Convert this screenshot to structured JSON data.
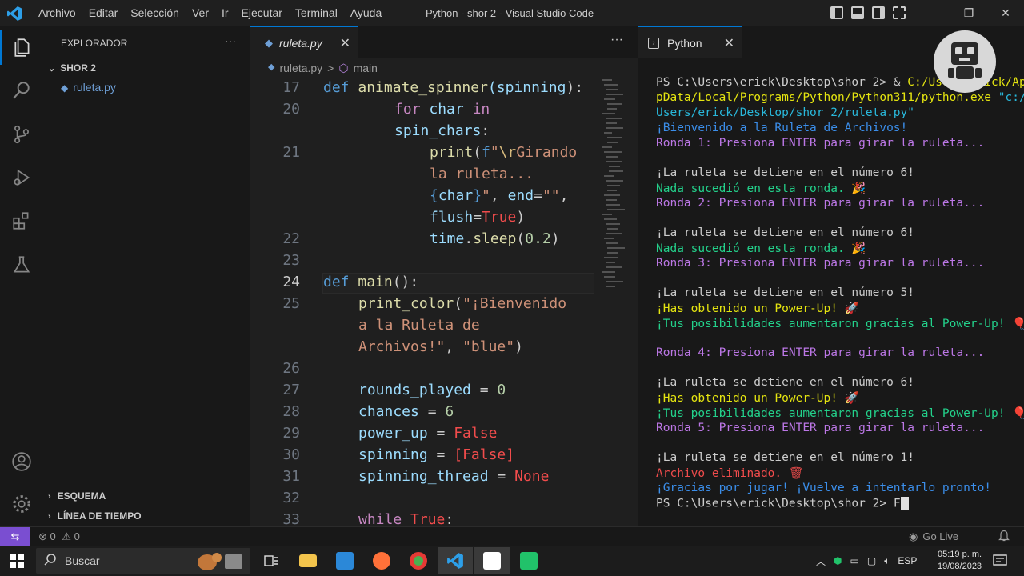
{
  "titlebar": {
    "menu": [
      "Archivo",
      "Editar",
      "Selección",
      "Ver",
      "Ir",
      "Ejecutar",
      "Terminal",
      "Ayuda"
    ],
    "title": "Python - shor 2 - Visual Studio Code",
    "controls": {
      "minimize": "—",
      "restore": "❐",
      "close": "✕"
    }
  },
  "sidebar": {
    "title": "EXPLORADOR",
    "more": "···",
    "folder": "SHOR 2",
    "files": [
      "ruleta.py"
    ],
    "outline": "ESQUEMA",
    "timeline": "LÍNEA DE TIEMPO"
  },
  "editor": {
    "tab": "ruleta.py",
    "tab_close": "✕",
    "more": "···",
    "breadcrumb": {
      "file": "ruleta.py",
      "sep": ">",
      "symbol": "main"
    },
    "line_numbers": [
      "17",
      "20",
      "21",
      "22",
      "23",
      "24",
      "25",
      "26",
      "27",
      "28",
      "29",
      "30",
      "31",
      "32",
      "33"
    ],
    "current_line": "24"
  },
  "panel": {
    "tab": "Python",
    "tab_close": "✕",
    "lines": [
      "PS C:\\Users\\erick\\Desktop\\shor 2> & ",
      "C:/Users/erick/Ap",
      "pData/Local/Programs/Python/Python311/python.exe ",
      "\"c:/",
      "Users/erick/Desktop/shor 2/ruleta.py\"",
      "¡Bienvenido a la Ruleta de Archivos!",
      "Ronda 1: Presiona ENTER para girar la ruleta...",
      "¡La ruleta se detiene en el número 6!",
      "Nada sucedió en esta ronda. 🎉",
      "Ronda 2: Presiona ENTER para girar la ruleta...",
      "¡La ruleta se detiene en el número 6!",
      "Nada sucedió en esta ronda. 🎉",
      "Ronda 3: Presiona ENTER para girar la ruleta...",
      "¡La ruleta se detiene en el número 5!",
      "¡Has obtenido un Power-Up! 🚀",
      "¡Tus posibilidades aumentaron gracias al Power-Up! 🎈",
      "Ronda 4: Presiona ENTER para girar la ruleta...",
      "¡La ruleta se detiene en el número 6!",
      "¡Has obtenido un Power-Up! 🚀",
      "¡Tus posibilidades aumentaron gracias al Power-Up! 🎈",
      "Ronda 5: Presiona ENTER para girar la ruleta...",
      "¡La ruleta se detiene en el número 1!",
      "Archivo eliminado. 🗑",
      "¡Gracias por jugar! ¡Vuelve a intentarlo pronto!",
      "PS C:\\Users\\erick\\Desktop\\shor 2> ",
      "F"
    ]
  },
  "statusbar": {
    "remote": "⇆",
    "errors": "⊗ 0",
    "warnings": "⚠ 0",
    "golive": "Go Live"
  },
  "taskbar": {
    "search": "Buscar",
    "lang": "ESP",
    "time": "05:19 p. m.",
    "date": "19/08/2023"
  },
  "colors": {
    "accent": "#0078d4",
    "remote": "#7a4ed1"
  }
}
